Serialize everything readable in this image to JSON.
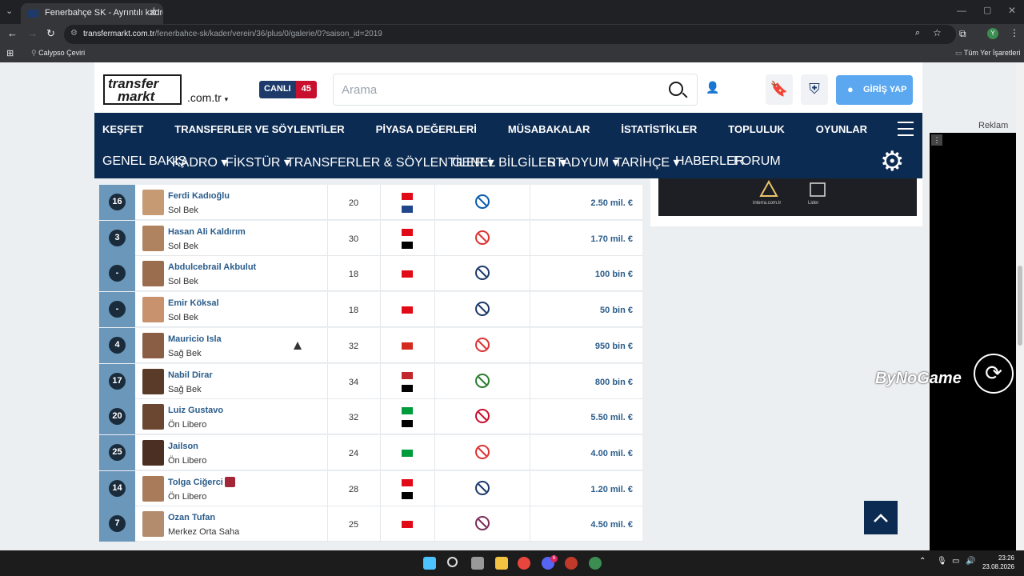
{
  "browser": {
    "tab_title": "Fenerbahçe SK - Ayrıntılı kadro",
    "url_host": "transfermarkt.com.tr",
    "url_path": "/fenerbahce-sk/kader/verein/36/plus/0/galerie/0?saison_id=2019",
    "bookmark_item": "Calypso Çeviri",
    "bookmarks_folder": "Tüm Yer İşaretleri",
    "profile_initial": "Y"
  },
  "header": {
    "logo_line1": "transfer",
    "logo_line2": "markt",
    "domain": ".com.tr",
    "live_label": "CANLI",
    "live_count": "45",
    "search_placeholder": "Arama",
    "login_label": "GİRİŞ YAP"
  },
  "main_nav": [
    "KEŞFET",
    "TRANSFERLER VE SÖYLENTİLER",
    "PİYASA DEĞERLERİ",
    "MÜSABAKALAR",
    "İSTATİSTİKLER",
    "TOPLULUK",
    "OYUNLAR"
  ],
  "sub_nav": [
    "GENEL BAKIŞ",
    "KADRO ▾",
    "FİKSTÜR ▾",
    "TRANSFERLER & SÖYLENTİLER ▾",
    "GENEL BİLGİLER ▾",
    "STADYUM ▾",
    "TARİHÇE ▾",
    "HABERLER",
    "FORUM"
  ],
  "players": [
    {
      "number": "16",
      "name": "Ferdi Kadıoğlu",
      "position": "Sol Bek",
      "age": "20",
      "flags": [
        "#e30a17",
        "#21468b"
      ],
      "club_color": "#0a5cab",
      "value": "2.50 mil. €",
      "photo": "#c69a72"
    },
    {
      "number": "3",
      "name": "Hasan Ali Kaldırım",
      "position": "Sol Bek",
      "age": "30",
      "flags": [
        "#e30a17",
        "#000000"
      ],
      "club_color": "#d33",
      "value": "1.70 mil. €",
      "photo": "#b08360"
    },
    {
      "number": "-",
      "name": "Abdulcebrail Akbulut",
      "position": "Sol Bek",
      "age": "18",
      "flags": [
        "#e30a17"
      ],
      "club_color": "#1d3a6b",
      "value": "100 bin €",
      "photo": "#9a6d4f"
    },
    {
      "number": "-",
      "name": "Emir Köksal",
      "position": "Sol Bek",
      "age": "18",
      "flags": [
        "#e30a17"
      ],
      "club_color": "#1d3a6b",
      "value": "50 bin €",
      "photo": "#c7926d"
    },
    {
      "number": "4",
      "name": "Mauricio Isla",
      "position": "Sağ Bek",
      "age": "32",
      "flags": [
        "#d52b1e"
      ],
      "club_color": "#d33",
      "value": "950 bin €",
      "photo": "#8a5e44"
    },
    {
      "number": "17",
      "name": "Nabil Dirar",
      "position": "Sağ Bek",
      "age": "34",
      "flags": [
        "#c1272d",
        "#000000"
      ],
      "club_color": "#2e7d32",
      "value": "800 bin €",
      "photo": "#5a3b2a"
    },
    {
      "number": "20",
      "name": "Luiz Gustavo",
      "position": "Ön Libero",
      "age": "32",
      "flags": [
        "#009c3b",
        "#000000"
      ],
      "club_color": "#c8102e",
      "value": "5.50 mil. €",
      "photo": "#6b4630"
    },
    {
      "number": "25",
      "name": "Jailson",
      "position": "Ön Libero",
      "age": "24",
      "flags": [
        "#009c3b"
      ],
      "club_color": "#d33",
      "value": "4.00 mil. €",
      "photo": "#4a2f22"
    },
    {
      "number": "14",
      "name": "Tolga Ciğerci",
      "position": "Ön Libero",
      "age": "28",
      "flags": [
        "#e30a17",
        "#000000"
      ],
      "club_color": "#1d3a6b",
      "value": "1.20 mil. €",
      "photo": "#a97b5a"
    },
    {
      "number": "7",
      "name": "Ozan Tufan",
      "position": "Merkez Orta Saha",
      "age": "25",
      "flags": [
        "#e30a17"
      ],
      "club_color": "#7b2d5a",
      "value": "4.50 mil. €",
      "photo": "#b38b6d"
    }
  ],
  "sidebar": {
    "ad_label": "Reklam"
  },
  "overlay": {
    "brand": "ByNoGame"
  },
  "taskbar": {
    "time": "23:26",
    "date": "23.08.2026",
    "badge": "6"
  }
}
